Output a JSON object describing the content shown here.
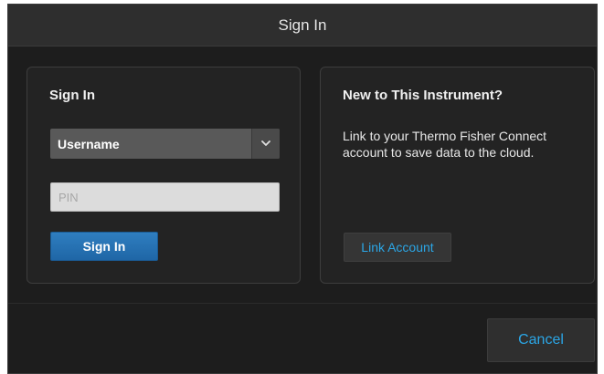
{
  "dialog": {
    "title": "Sign In"
  },
  "sign_in_panel": {
    "heading": "Sign In",
    "username_select": {
      "value": "Username",
      "icon": "chevron-down-icon"
    },
    "pin_input": {
      "value": "",
      "placeholder": "PIN"
    },
    "sign_in_label": "Sign In"
  },
  "new_panel": {
    "heading": "New to This Instrument?",
    "description": "Link to your Thermo Fisher Connect account to save data to the cloud.",
    "link_account_label": "Link Account"
  },
  "footer": {
    "cancel_label": "Cancel"
  },
  "colors": {
    "background": "#1d1d1d",
    "titlebar": "#2e2e2e",
    "primary_button": "#2372b5",
    "link_text": "#2ba6e6"
  }
}
